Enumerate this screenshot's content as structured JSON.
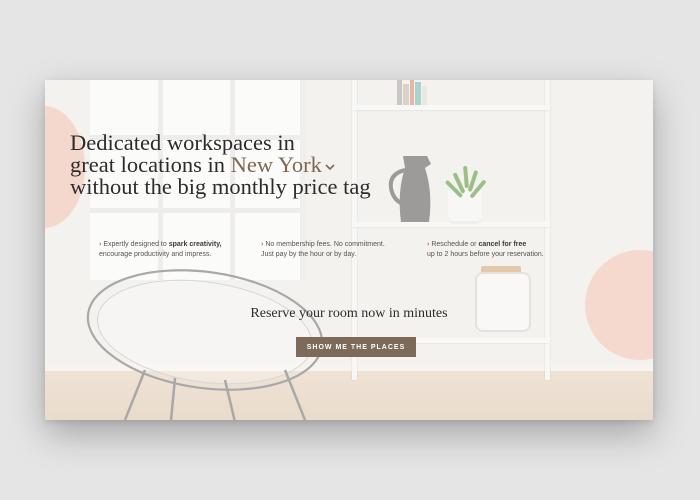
{
  "hero": {
    "headline_line1": "Dedicated workspaces in",
    "headline_line2_prefix": "great locations in ",
    "city": "New York",
    "headline_line3": "without the big monthly price tag"
  },
  "features": [
    {
      "pre": "Expertly designed to ",
      "bold": "spark creativity,",
      "line2": "encourage productivity and impress."
    },
    {
      "pre": "No membership fees. No commitment.",
      "bold": "",
      "line2": "Just pay by the hour or by day."
    },
    {
      "pre": "Reschedule or ",
      "bold": "cancel for free",
      "line2": "up to 2 hours before your reservation."
    }
  ],
  "subheading": "Reserve your room now in minutes",
  "cta_label": "SHOW ME THE PLACES",
  "icons": {
    "feature_arrow": "chevron-right-icon",
    "city_dropdown": "chevron-down-icon"
  },
  "colors": {
    "accent": "#7e6852",
    "button": "#7e6a58",
    "arrow": "#c96a3c",
    "blob": "#f4d8cd"
  }
}
